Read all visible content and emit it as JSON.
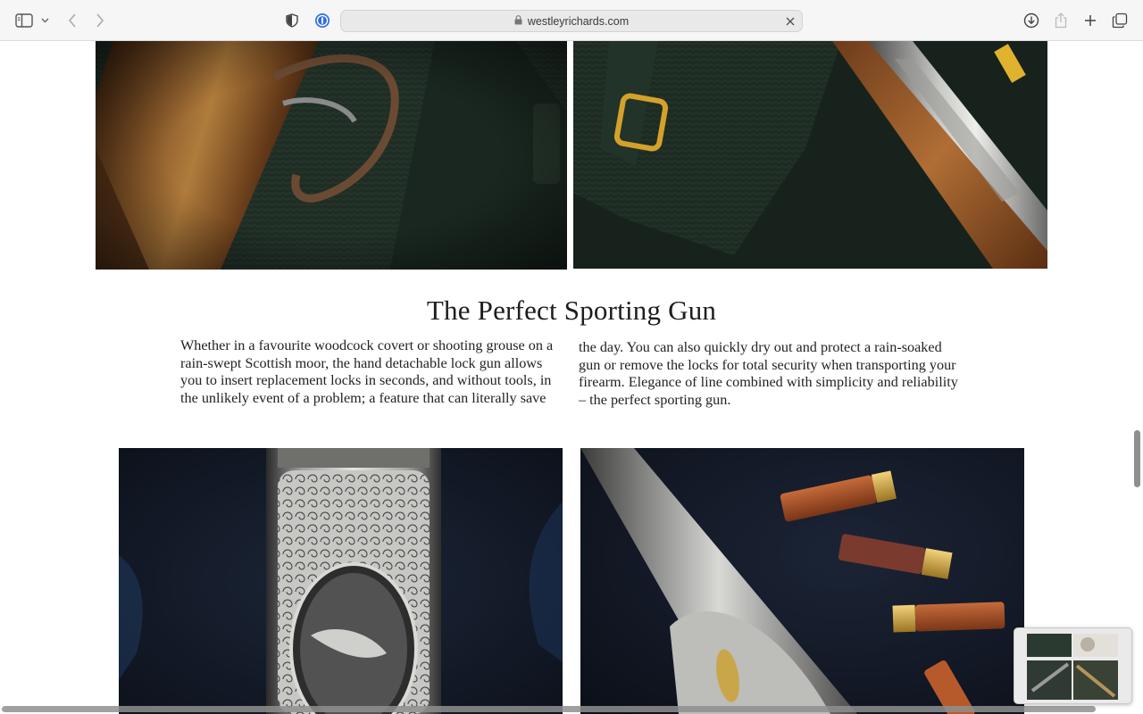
{
  "browser": {
    "url": "westleyrichards.com",
    "icons": {
      "sidebar": "sidebar-icon",
      "sidebar_menu": "chevron-down-icon",
      "back": "chevron-left-icon",
      "forward": "chevron-right-icon",
      "privacy": "shield-icon",
      "password_manager": "1password-icon",
      "lock": "lock-icon",
      "clear": "close-icon",
      "downloads": "download-icon",
      "share": "share-icon",
      "new_tab": "plus-icon",
      "tabs": "tabs-overview-icon"
    }
  },
  "page": {
    "heading": "The Perfect Sporting Gun",
    "paragraph_col1": "Whether in a favourite woodcock covert or shooting grouse on a rain-swept Scottish moor, the hand detachable lock gun allows you to insert replacement locks in seconds, and without tools, in the unlikely event of a problem; a feature that can literally save",
    "paragraph_col2": "the day. You can also quickly dry out and protect a rain-soaked gun or remove the locks for total security when transporting your firearm. Elegance of line combined with simplicity and reliability – the perfect sporting gun.",
    "images": [
      {
        "name": "gun-stock-on-leather-photo"
      },
      {
        "name": "leather-pouch-and-engraved-barrel-photo"
      },
      {
        "name": "engraved-action-woodcock-photo"
      },
      {
        "name": "engraved-gun-with-cartridges-photo"
      }
    ]
  },
  "colors": {
    "toolbar_bg": "#f6f6f6",
    "address_bg": "#e9e9e9",
    "leather_green": "#1e2c24",
    "dark_blue_bg": "#141c2b",
    "heading_text": "#1d1d1d"
  }
}
